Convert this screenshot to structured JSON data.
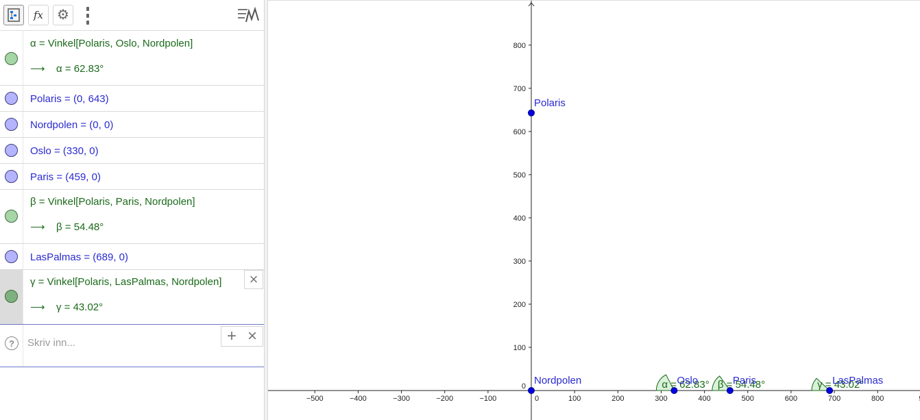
{
  "toolbar": {
    "algebra_icon": "tree-list-icon",
    "fx_label": "fx",
    "settings_icon": "gear-icon",
    "more_icon": "vertical-dots-icon",
    "style_icon": "style-bar-icon"
  },
  "algebra": {
    "rows": [
      {
        "kind": "angle",
        "definition": "α = Vinkel[Polaris, Oslo, Nordpolen]",
        "arrow": "⟶",
        "value": "α = 62.83°"
      },
      {
        "kind": "point",
        "definition": "Polaris = (0, 643)"
      },
      {
        "kind": "point",
        "definition": "Nordpolen = (0, 0)"
      },
      {
        "kind": "point",
        "definition": "Oslo = (330, 0)"
      },
      {
        "kind": "point",
        "definition": "Paris = (459, 0)"
      },
      {
        "kind": "angle",
        "definition": "β = Vinkel[Polaris, Paris, Nordpolen]",
        "arrow": "⟶",
        "value": "β = 54.48°"
      },
      {
        "kind": "point",
        "definition": "LasPalmas = (689, 0)"
      },
      {
        "kind": "angle",
        "definition": "γ = Vinkel[Polaris, LasPalmas, Nordpolen]",
        "arrow": "⟶",
        "value": "γ = 43.02°",
        "selected": true
      }
    ],
    "row_close_label": "×",
    "input": {
      "placeholder": "Skriv inn...",
      "value": "",
      "help_label": "?",
      "add_label": "+",
      "close_label": "×"
    }
  },
  "graphics": {
    "x_ticks": [
      "−500",
      "−400",
      "−300",
      "−200",
      "−100",
      "0",
      "100",
      "200",
      "300",
      "400",
      "500",
      "600",
      "700",
      "800",
      "9"
    ],
    "y_ticks": [
      "100",
      "200",
      "300",
      "400",
      "500",
      "600",
      "700",
      "800"
    ],
    "y_zero_label": "0",
    "points": [
      {
        "name": "Polaris",
        "x": 0,
        "y": 643
      },
      {
        "name": "Nordpolen",
        "x": 0,
        "y": 0
      },
      {
        "name": "Oslo",
        "x": 330,
        "y": 0
      },
      {
        "name": "Paris",
        "x": 459,
        "y": 0
      },
      {
        "name": "LasPalmas",
        "x": 689,
        "y": 0
      }
    ],
    "angles": [
      {
        "label": "α = 62.83°",
        "vertex": "Oslo",
        "degrees": 62.83
      },
      {
        "label": "β = 54.48°",
        "vertex": "Paris",
        "degrees": 54.48
      },
      {
        "label": "γ = 43.02°",
        "vertex": "LasPalmas",
        "degrees": 43.02
      }
    ],
    "colors": {
      "point": "#0000e0",
      "point_label": "#2a2ad0",
      "angle_fill": "#d6efd6",
      "angle_stroke": "#1a6a1a",
      "axis": "#222222"
    }
  }
}
